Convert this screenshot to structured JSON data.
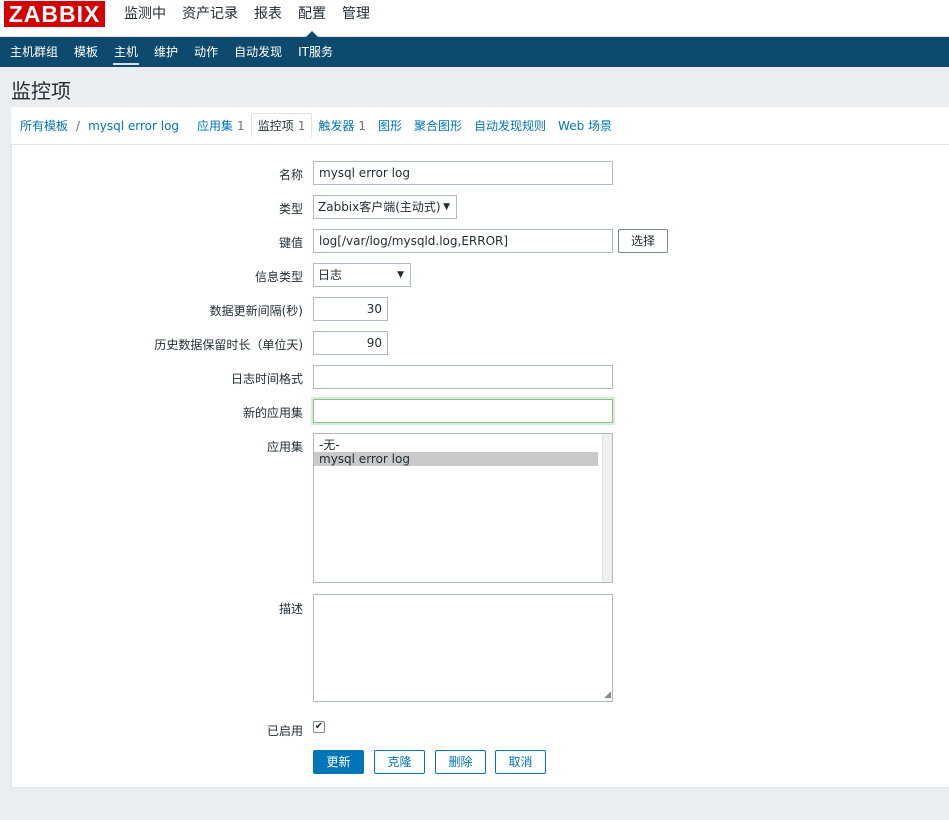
{
  "header": {
    "logo": "ZABBIX",
    "menu": [
      "监测中",
      "资产记录",
      "报表",
      "配置",
      "管理"
    ],
    "active_menu": "配置"
  },
  "submenu": {
    "items": [
      "主机群组",
      "模板",
      "主机",
      "维护",
      "动作",
      "自动发现",
      "IT服务"
    ],
    "active": "主机"
  },
  "page": {
    "title": "监控项"
  },
  "breadcrumb": {
    "all_templates": "所有模板",
    "separator": "/",
    "host": "mysql error log"
  },
  "tabs": {
    "applications": {
      "label": "应用集",
      "count": "1"
    },
    "items": {
      "label": "监控项",
      "count": "1"
    },
    "triggers": {
      "label": "触发器",
      "count": "1"
    },
    "graphs": {
      "label": "图形"
    },
    "screens": {
      "label": "聚合图形"
    },
    "discovery": {
      "label": "自动发现规则"
    },
    "web": {
      "label": "Web 场景"
    }
  },
  "form": {
    "name": {
      "label": "名称",
      "value": "mysql error log"
    },
    "type": {
      "label": "类型",
      "value": "Zabbix客户端(主动式)"
    },
    "key": {
      "label": "键值",
      "value": "log[/var/log/mysqld.log,ERROR]",
      "select_button": "选择"
    },
    "info_type": {
      "label": "信息类型",
      "value": "日志"
    },
    "update_interval": {
      "label": "数据更新间隔(秒)",
      "value": "30"
    },
    "history": {
      "label": "历史数据保留时长（单位天)",
      "value": "90"
    },
    "log_time_format": {
      "label": "日志时间格式",
      "value": ""
    },
    "new_application": {
      "label": "新的应用集",
      "value": ""
    },
    "applications": {
      "label": "应用集",
      "options": [
        "-无-",
        "mysql error log"
      ],
      "selected": "mysql error log"
    },
    "description": {
      "label": "描述",
      "value": ""
    },
    "enabled": {
      "label": "已启用",
      "checked": true,
      "check_glyph": "✔"
    }
  },
  "buttons": {
    "update": "更新",
    "clone": "克隆",
    "delete": "删除",
    "cancel": "取消"
  },
  "icons": {
    "dropdown_arrow": "▼",
    "resize_grip": "◢"
  }
}
